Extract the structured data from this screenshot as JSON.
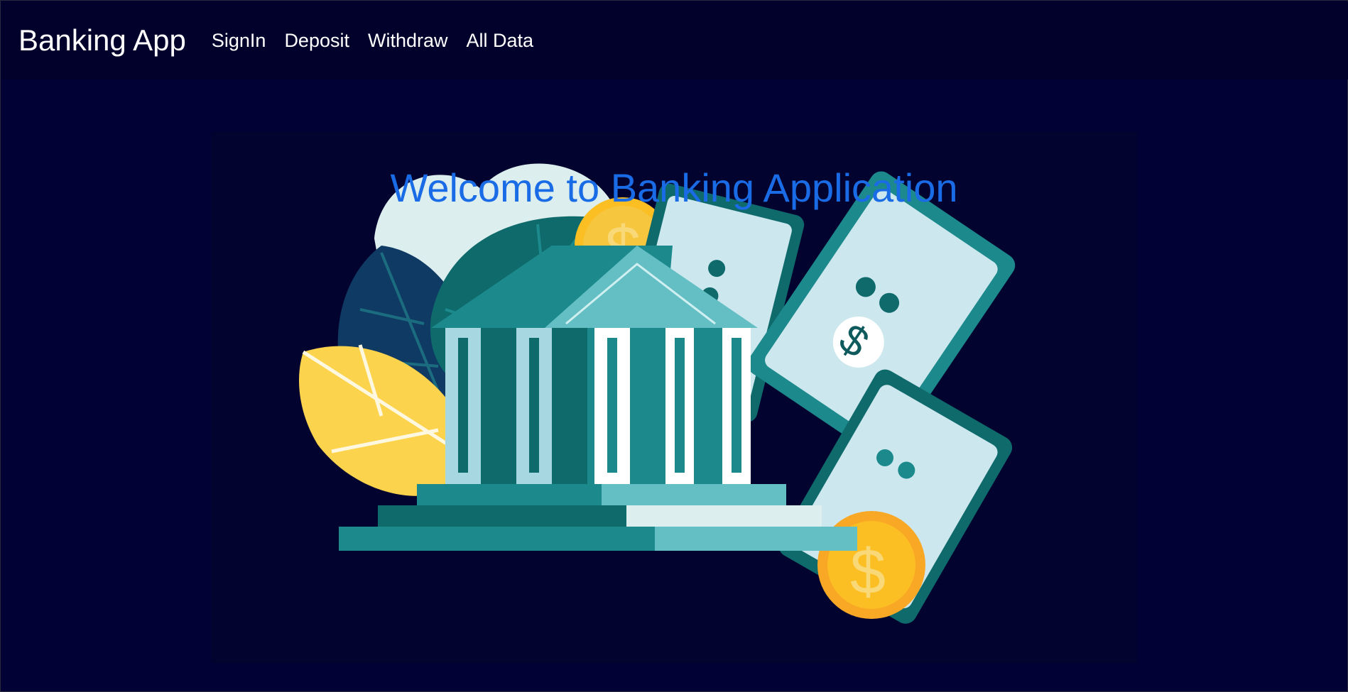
{
  "nav": {
    "brand": "Banking App",
    "links": [
      "SignIn",
      "Deposit",
      "Withdraw",
      "All Data"
    ]
  },
  "hero": {
    "title": "Welcome to Banking Application",
    "image_icon": "bank-illustration-icon"
  },
  "colors": {
    "page_background": "#020136",
    "navbar_background": "#02012c",
    "title_color": "#1a6be6",
    "teal": "#1c8a8c",
    "light_teal": "#64bfc4",
    "gold": "#fbbf24"
  }
}
